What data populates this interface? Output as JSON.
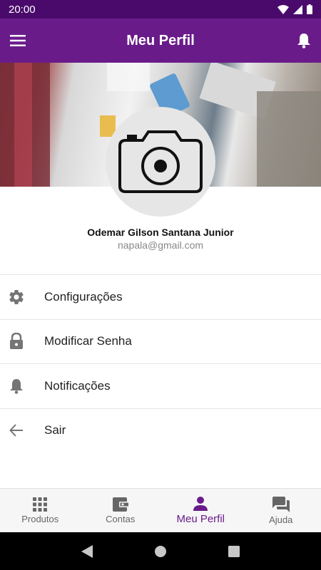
{
  "status_bar": {
    "time": "20:00"
  },
  "app_bar": {
    "title": "Meu Perfil"
  },
  "profile": {
    "name": "Odemar Gilson Santana Junior",
    "email": "napala@gmail.com"
  },
  "menu": {
    "items": [
      {
        "label": "Configurações",
        "icon": "gear-icon"
      },
      {
        "label": "Modificar Senha",
        "icon": "lock-icon"
      },
      {
        "label": "Notificações",
        "icon": "bell-icon"
      },
      {
        "label": "Sair",
        "icon": "arrow-left-icon"
      }
    ]
  },
  "bottom_nav": {
    "items": [
      {
        "label": "Produtos",
        "icon": "grid-icon"
      },
      {
        "label": "Contas",
        "icon": "wallet-icon"
      },
      {
        "label": "Meu Perfil",
        "icon": "person-icon",
        "active": true
      },
      {
        "label": "Ajuda",
        "icon": "chat-icon"
      }
    ]
  },
  "colors": {
    "primary": "#6a1b8a",
    "status_bar": "#4a0a6b"
  }
}
